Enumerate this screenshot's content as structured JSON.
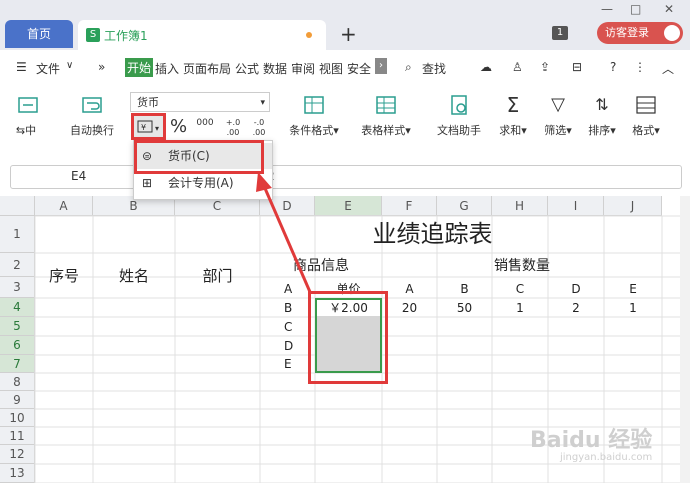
{
  "tabs": {
    "home": "首页",
    "workbook": "工作簿1",
    "add": "+",
    "badge": "1",
    "login": "访客登录"
  },
  "menu": {
    "file": "文件",
    "items": [
      "开始",
      "插入",
      "页面布局",
      "公式",
      "数据",
      "审阅",
      "视图",
      "安全"
    ],
    "search": "查找"
  },
  "ribbon": {
    "format_value": "货币",
    "left_labels": [
      "中",
      "自动换行"
    ],
    "percent": "%",
    "thousands": "000",
    "dec_inc": "+.0 .00",
    "dec_dec": "-.0 .00",
    "cond_format": "条件格式",
    "table_style": "表格样式",
    "doc_helper": "文档助手",
    "sum": "求和",
    "filter": "筛选",
    "sort": "排序",
    "format": "格式"
  },
  "dropdown": {
    "currency": "货币(C)",
    "accounting": "会计专用(A)"
  },
  "formula": {
    "cell_ref": "E4",
    "value": "2"
  },
  "columns": [
    "A",
    "B",
    "C",
    "D",
    "E",
    "F",
    "G",
    "H",
    "I",
    "J"
  ],
  "rows": [
    "1",
    "2",
    "3",
    "4",
    "5",
    "6",
    "7",
    "8",
    "9",
    "10",
    "11",
    "12",
    "13"
  ],
  "sheet": {
    "title": "业绩追踪表",
    "headers": {
      "seq": "序号",
      "name": "姓名",
      "dept": "部门",
      "product_info": "商品信息",
      "sales_qty": "销售数量",
      "unit_price": "单价"
    },
    "row3": [
      "A",
      "A",
      "B",
      "C",
      "D",
      "E"
    ],
    "d_labels": [
      "B",
      "C",
      "D",
      "E"
    ],
    "price": "￥2.00",
    "sales_row4": [
      "20",
      "50",
      "1",
      "2",
      "1"
    ]
  },
  "watermark": "Baidu 经验",
  "watermark_url": "jingyan.baidu.com",
  "colors": {
    "accent_green": "#3a9b4c",
    "highlight_red": "#e03a3a",
    "tab_blue": "#4a72c9"
  }
}
